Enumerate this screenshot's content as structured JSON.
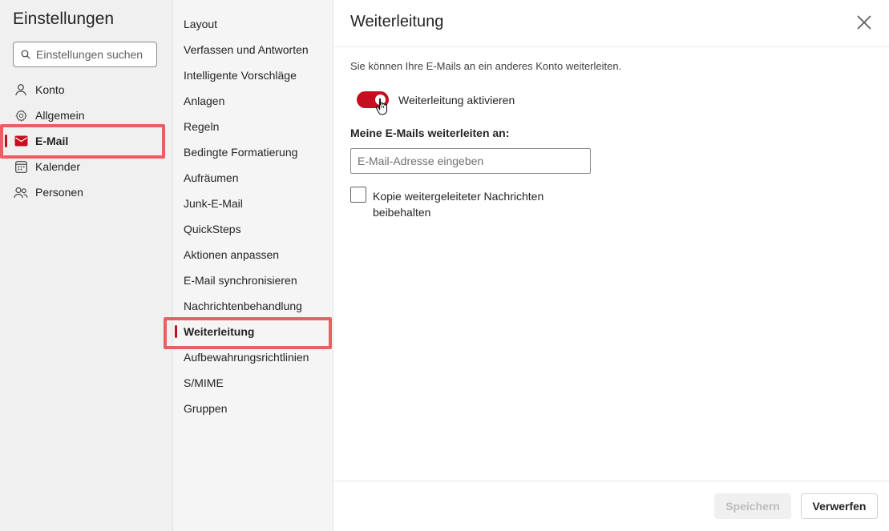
{
  "settings": {
    "title": "Einstellungen",
    "search_placeholder": "Einstellungen suchen"
  },
  "nav": {
    "items": [
      {
        "label": "Konto",
        "icon": "person-icon"
      },
      {
        "label": "Allgemein",
        "icon": "gear-icon"
      },
      {
        "label": "E-Mail",
        "icon": "mail-icon",
        "active": true
      },
      {
        "label": "Kalender",
        "icon": "calendar-icon"
      },
      {
        "label": "Personen",
        "icon": "people-icon"
      }
    ]
  },
  "submenu": {
    "items": [
      {
        "label": "Layout"
      },
      {
        "label": "Verfassen und Antworten"
      },
      {
        "label": "Intelligente Vorschläge"
      },
      {
        "label": "Anlagen"
      },
      {
        "label": "Regeln"
      },
      {
        "label": "Bedingte Formatierung"
      },
      {
        "label": "Aufräumen"
      },
      {
        "label": "Junk-E-Mail"
      },
      {
        "label": "QuickSteps"
      },
      {
        "label": "Aktionen anpassen"
      },
      {
        "label": "E-Mail synchronisieren"
      },
      {
        "label": "Nachrichtenbehandlung"
      },
      {
        "label": "Weiterleitung",
        "active": true
      },
      {
        "label": "Aufbewahrungsrichtlinien"
      },
      {
        "label": "S/MIME"
      },
      {
        "label": "Gruppen"
      }
    ]
  },
  "main": {
    "title": "Weiterleitung",
    "description": "Sie können Ihre E-Mails an ein anderes Konto weiterleiten.",
    "toggle_label": "Weiterleitung aktivieren",
    "toggle_on": true,
    "forward_to_label": "Meine E-Mails weiterleiten an:",
    "email_placeholder": "E-Mail-Adresse eingeben",
    "email_value": "",
    "keep_copy_label": "Kopie weitergeleiteter Nachrichten beibehalten",
    "keep_copy_checked": false,
    "save_label": "Speichern",
    "discard_label": "Verwerfen"
  },
  "colors": {
    "accent": "#c50f1f",
    "highlight": "#eb5f63"
  }
}
